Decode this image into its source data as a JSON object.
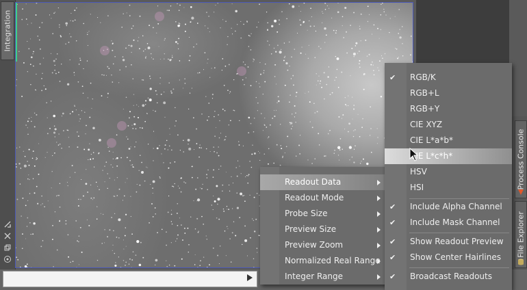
{
  "left_panel": {
    "integration_tab": "Integration",
    "icons": [
      "resize-icon",
      "fit-icon",
      "window-icon",
      "target-icon"
    ]
  },
  "right_panel": {
    "tabs": [
      {
        "label": "Process Console",
        "icon": "process-icon"
      },
      {
        "label": "File Explorer",
        "icon": "cylinder-icon"
      }
    ]
  },
  "context_menu": {
    "items": [
      {
        "label": "Readout Data",
        "submenu": true,
        "active": true
      },
      {
        "label": "Readout Mode",
        "submenu": true
      },
      {
        "label": "Probe Size",
        "submenu": true
      },
      {
        "label": "Preview Size",
        "submenu": true
      },
      {
        "label": "Preview Zoom",
        "submenu": true
      },
      {
        "label": "Normalized Real Range",
        "submenu": true
      },
      {
        "label": "Integer Range",
        "submenu": true
      }
    ]
  },
  "readout_data_submenu": {
    "items": [
      {
        "label": "RGB/K",
        "checked": true
      },
      {
        "label": "RGB+L",
        "checked": false
      },
      {
        "label": "RGB+Y",
        "checked": false
      },
      {
        "label": "CIE XYZ",
        "checked": false
      },
      {
        "label": "CIE L*a*b*",
        "checked": false
      },
      {
        "label": "CIE L*c*h*",
        "checked": false,
        "active": true
      },
      {
        "label": "HSV",
        "checked": false
      },
      {
        "label": "HSI",
        "checked": false
      },
      {
        "label": "Include Alpha Channel",
        "checked": true
      },
      {
        "label": "Include Mask Channel",
        "checked": true
      },
      {
        "label": "Show Readout Preview",
        "checked": true
      },
      {
        "label": "Show Center Hairlines",
        "checked": true
      },
      {
        "label": "Broadcast Readouts",
        "checked": true
      }
    ]
  },
  "colors": {
    "view_border": "#4a58b8",
    "accent_green": "#3fd08a",
    "menu_bg": "#6b6b6b",
    "process_icon": "#e0582c",
    "file_icon": "#d9c27a"
  }
}
